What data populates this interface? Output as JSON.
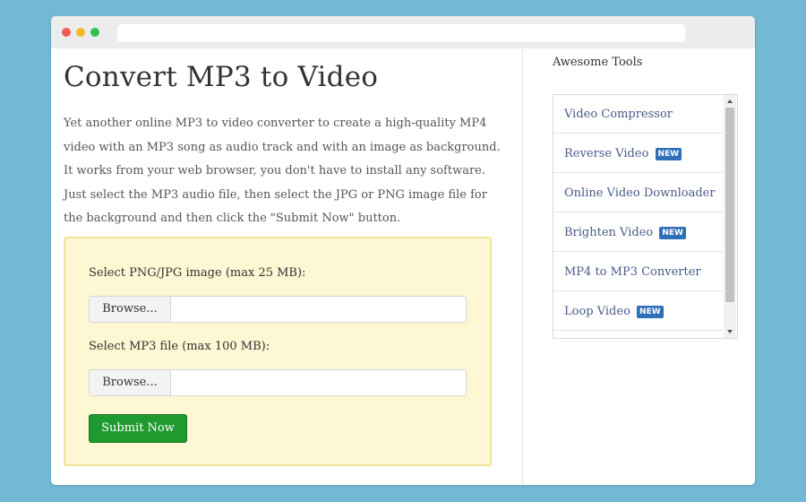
{
  "page": {
    "title": "Convert MP3 to Video",
    "description": "Yet another online MP3 to video converter to create a high-quality MP4 video with an MP3 song as audio track and with an image as background. It works from your web browser, you don't have to install any software. Just select the MP3 audio file, then select the JPG or PNG image file for the background and then click the \"Submit Now\" button."
  },
  "form": {
    "image_label": "Select PNG/JPG image (max 25 MB):",
    "image_browse": "Browse...",
    "mp3_label": "Select MP3 file (max 100 MB):",
    "mp3_browse": "Browse...",
    "submit_label": "Submit Now"
  },
  "sidebar": {
    "title": "Awesome Tools",
    "items": [
      {
        "label": "Video Compressor",
        "badge": ""
      },
      {
        "label": "Reverse Video",
        "badge": "NEW"
      },
      {
        "label": "Online Video Downloader",
        "badge": ""
      },
      {
        "label": "Brighten Video",
        "badge": "NEW"
      },
      {
        "label": "MP4 to MP3 Converter",
        "badge": ""
      },
      {
        "label": "Loop Video",
        "badge": "NEW"
      }
    ]
  },
  "colors": {
    "background": "#73b9d4",
    "submit": "#1f9a2e",
    "badge": "#2f6fb8",
    "upload_box": "#fdf7d3",
    "link": "#4a5a8a"
  }
}
